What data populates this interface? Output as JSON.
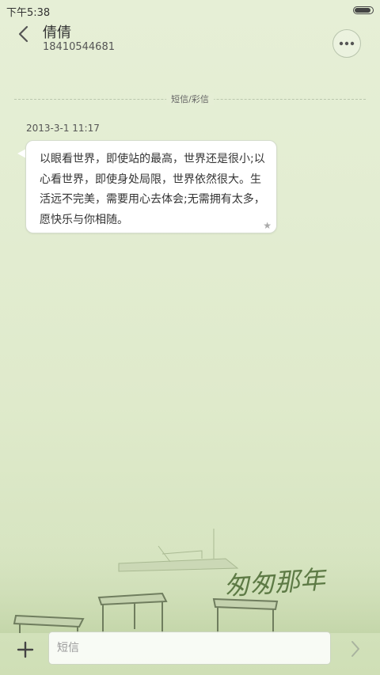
{
  "status_bar": {
    "time": "下午5:38",
    "battery_level": 0.9
  },
  "header": {
    "contact_name": "倩倩",
    "contact_number": "18410544681"
  },
  "thread": {
    "divider_label": "短信/彩信",
    "messages": [
      {
        "timestamp": "2013-3-1 11:17",
        "text": "以眼看世界，即使站的最高，世界还是很小;以心看世界，即使身处局限，世界依然很大。生活远不完美，需要用心去体会;无需拥有太多，愿快乐与你相随。"
      }
    ]
  },
  "background": {
    "calligraphy_text": "匆匆那年",
    "accent_color": "#6f8a4f"
  },
  "composer": {
    "placeholder": "短信",
    "value": ""
  },
  "icons": {
    "back": "chevron-left-icon",
    "more": "more-dots-icon",
    "star": "star-icon",
    "add": "plus-icon",
    "send": "chevron-right-icon"
  }
}
